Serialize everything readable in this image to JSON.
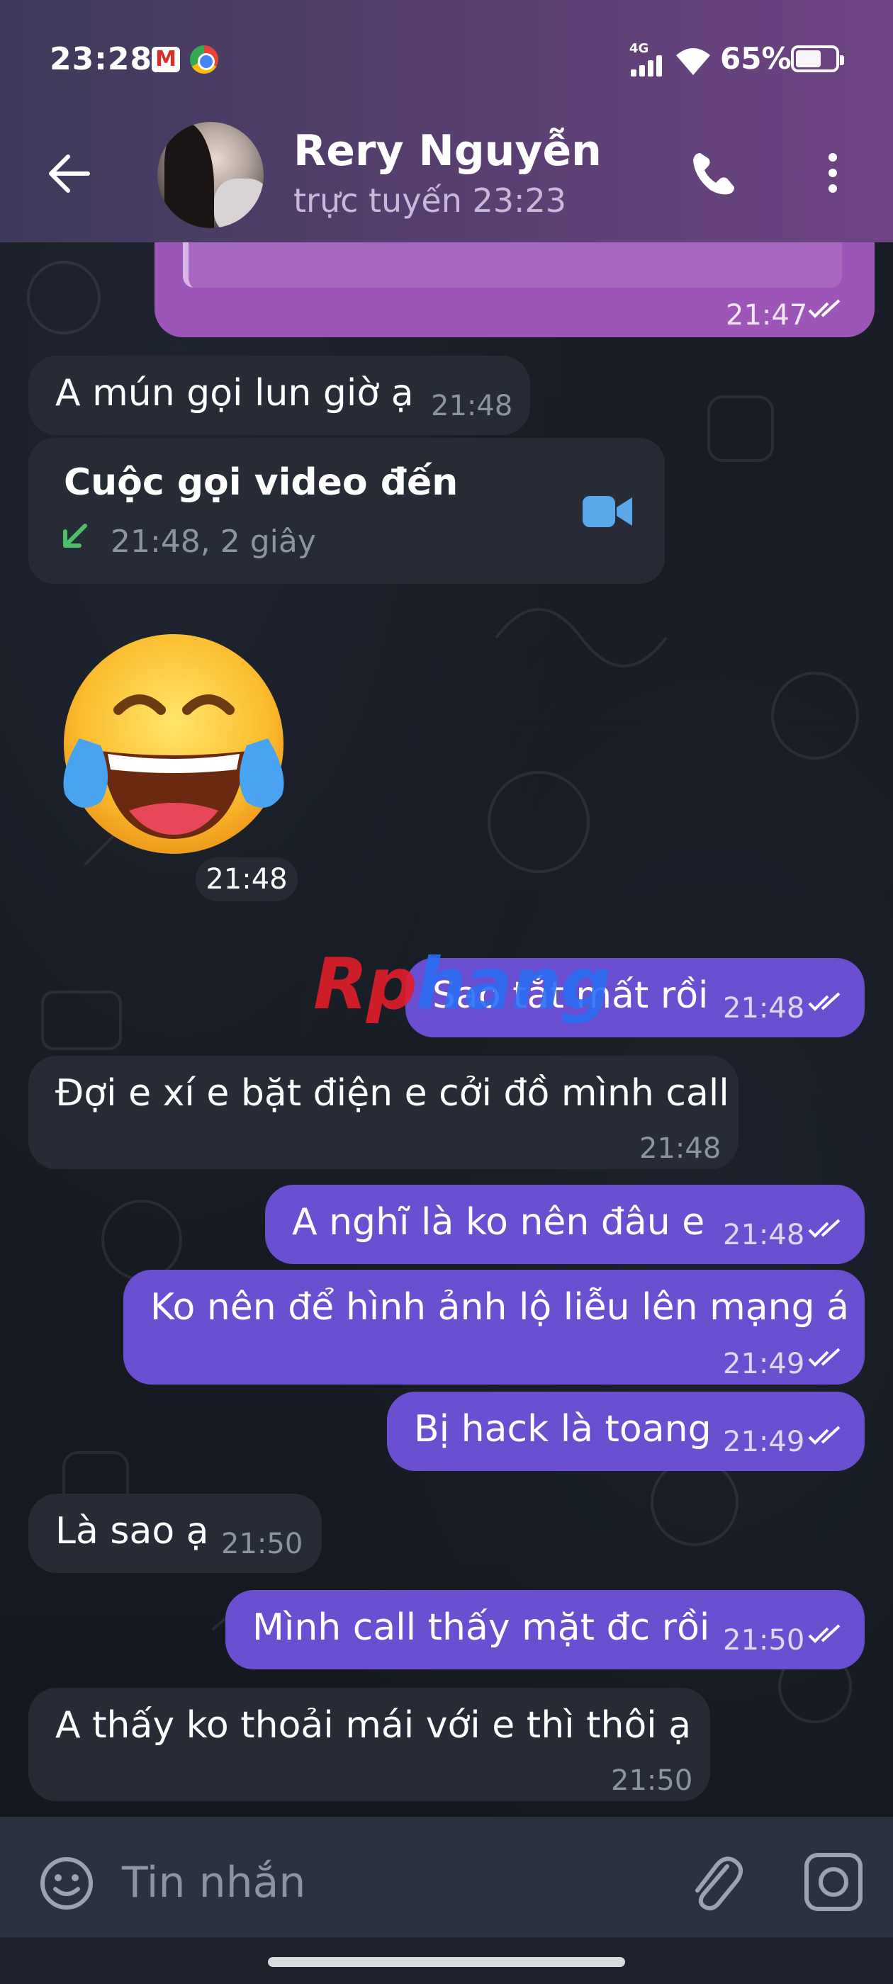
{
  "statusbar": {
    "time": "23:28",
    "network": "4G",
    "battery": "65%",
    "battery_level": 0.65
  },
  "header": {
    "contact_name": "Rery Nguyễn",
    "contact_status": "trực tuyến 23:23"
  },
  "messages": {
    "m1": {
      "time": "21:47"
    },
    "m2": {
      "text": "A mún gọi lun giờ ạ",
      "time": "21:48"
    },
    "call": {
      "title": "Cuộc gọi video đến",
      "detail": "21:48, 2 giây"
    },
    "sticker": {
      "time": "21:48"
    },
    "m3": {
      "text": "Sao tắt mất rồi",
      "time": "21:48"
    },
    "m4": {
      "text": "Đợi e xí e bặt điện e cởi đồ mình call",
      "time": "21:48"
    },
    "m5": {
      "text": "A nghĩ là ko nên đâu e",
      "time": "21:48"
    },
    "m6": {
      "text": "Ko nên để hình ảnh lộ liễu lên mạng á",
      "time": "21:49"
    },
    "m7": {
      "text": "Bị hack là toang",
      "time": "21:49"
    },
    "m8": {
      "text": "Là sao ạ",
      "time": "21:50"
    },
    "m9": {
      "text": "Mình call thấy mặt đc rồi",
      "time": "21:50"
    },
    "m10": {
      "text": "A thấy ko thoải mái với e thì thôi ạ",
      "time": "21:50"
    }
  },
  "watermark": {
    "part1": "Rp",
    "part2": "hang"
  },
  "input": {
    "placeholder": "Tin nhắn"
  },
  "colors": {
    "accent_purple": "#8b52b8",
    "outgoing": "#6a4fd0",
    "incoming": "#262b35"
  }
}
